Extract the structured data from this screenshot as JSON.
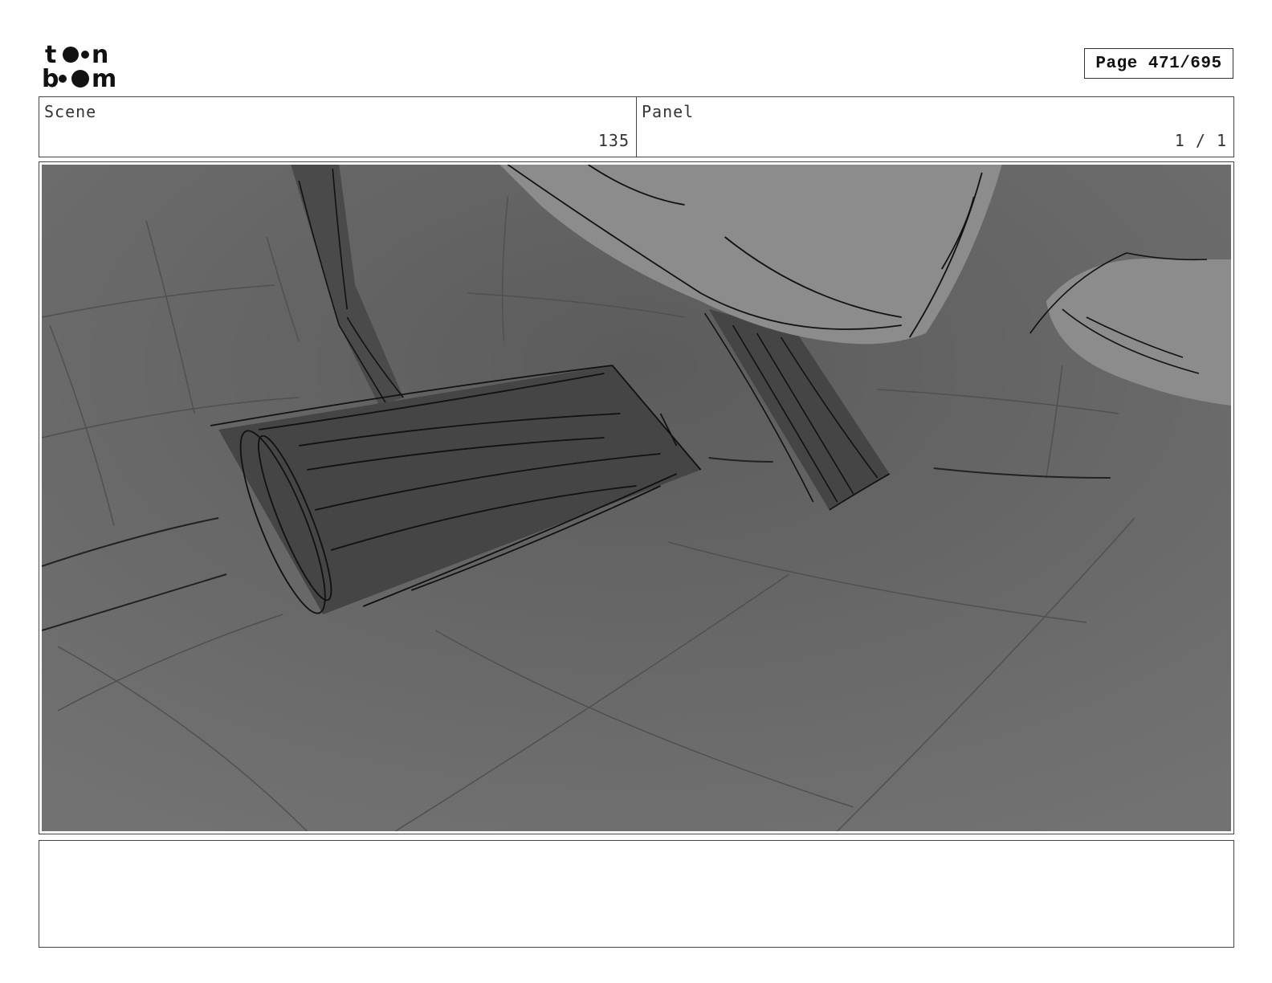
{
  "header": {
    "logo_text_top": "toon",
    "logo_text_bottom": "boom",
    "page_label": "Page 471/695"
  },
  "scene": {
    "label": "Scene",
    "value": "135"
  },
  "panel": {
    "label": "Panel",
    "value": "1 / 1"
  },
  "image": {
    "icon": "storyboard-sketch",
    "background_color": "#6b6b6b",
    "object_color": "#4a4a4a",
    "highlight_color": "#8c8c8c"
  },
  "notes": {
    "text": ""
  }
}
